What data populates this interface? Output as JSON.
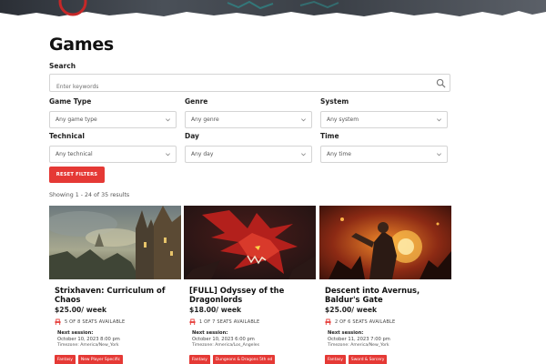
{
  "page": {
    "title": "Games"
  },
  "search": {
    "label": "Search",
    "placeholder": "Enter keywords",
    "icon": "search-icon"
  },
  "filters": [
    {
      "label": "Game Type",
      "value": "Any game type"
    },
    {
      "label": "Genre",
      "value": "Any genre"
    },
    {
      "label": "System",
      "value": "Any system"
    },
    {
      "label": "Technical",
      "value": "Any technical"
    },
    {
      "label": "Day",
      "value": "Any day"
    },
    {
      "label": "Time",
      "value": "Any time"
    }
  ],
  "reset_label": "RESET FILTERS",
  "showing_text": "Showing 1 - 24 of 35 results",
  "colors": {
    "accent": "#e53935"
  },
  "cards": [
    {
      "title": "Strixhaven: Curriculum of Chaos",
      "price": "$25.00/ week",
      "seats": "5 OF 8 SEATS AVAILABLE",
      "next_label": "Next session:",
      "date": "October 10, 2023 8:00 pm",
      "timezone": "Timezone: America/New_York",
      "tags": [
        "Fantasy",
        "New Player Specific"
      ]
    },
    {
      "title": "[FULL] Odyssey of the Dragonlords",
      "price": "$18.00/ week",
      "seats": "1 OF 7 SEATS AVAILABLE",
      "next_label": "Next session:",
      "date": "October 10, 2023 6:00 pm",
      "timezone": "Timezone: America/Los_Angeles",
      "tags": [
        "Fantasy",
        "Dungeons & Dragons 5th ed"
      ]
    },
    {
      "title": "Descent into Avernus, Baldur's Gate",
      "price": "$25.00/ week",
      "seats": "2 OF 6 SEATS AVAILABLE",
      "next_label": "Next session:",
      "date": "October 11, 2023 7:00 pm",
      "timezone": "Timezone: America/New_York",
      "tags": [
        "Fantasy",
        "Sword & Sorcery"
      ]
    }
  ]
}
